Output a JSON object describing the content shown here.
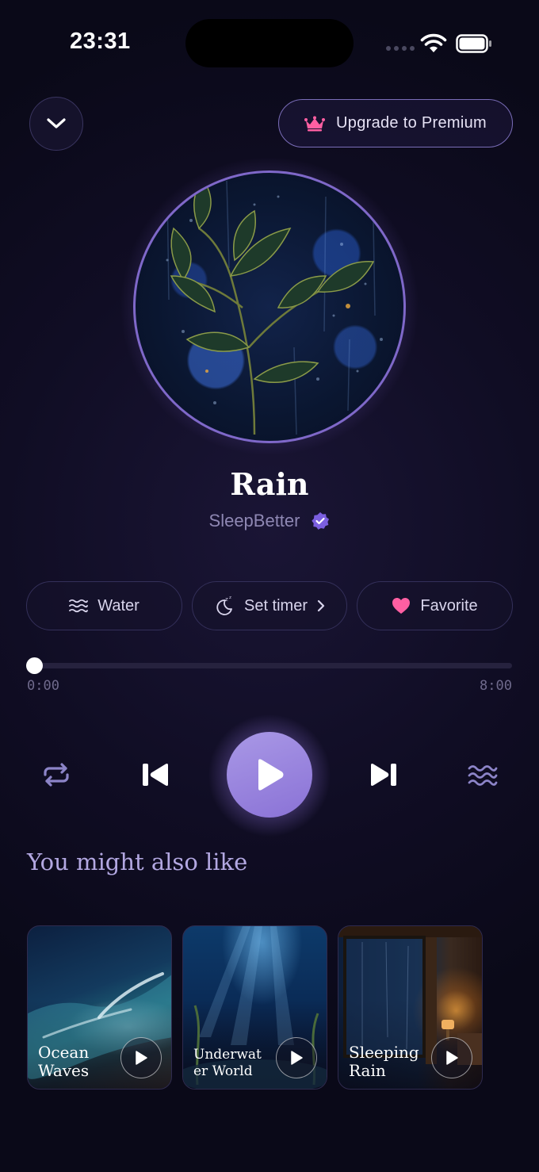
{
  "status_bar": {
    "time": "23:31"
  },
  "header": {
    "premium_label": "Upgrade to Premium"
  },
  "track": {
    "title": "Rain",
    "artist": "SleepBetter"
  },
  "chips": {
    "category_label": "Water",
    "timer_label": "Set timer",
    "favorite_label": "Favorite"
  },
  "progress": {
    "current": "0:00",
    "total": "8:00",
    "fraction": 0
  },
  "recommendations": {
    "title": "You might also like",
    "items": [
      {
        "line1": "Ocean",
        "line2": "Waves"
      },
      {
        "line1": "Underwat",
        "line2": "er World"
      },
      {
        "line1": "Sleeping",
        "line2": "Rain"
      }
    ]
  },
  "colors": {
    "accent": "#8a72d6",
    "favorite": "#ff5fa2",
    "verified": "#7b5fe0"
  }
}
